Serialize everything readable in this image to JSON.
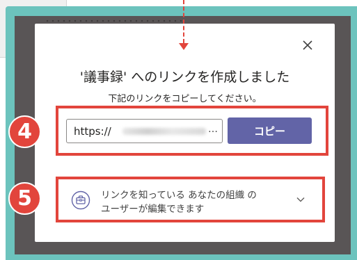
{
  "dialog": {
    "title": "'議事録' へのリンクを作成しました",
    "subtitle": "下記のリンクをコピーしてください。",
    "link_field_value": "https://",
    "link_ellipsis": "…",
    "copy_button_label": "コピー",
    "permission_line1": "リンクを知っている あなたの組織 の",
    "permission_line2": "ユーザーが編集できます"
  },
  "annotations": {
    "step4": "4",
    "step5": "5"
  },
  "icons": {
    "close": "close-icon",
    "permission": "briefcase-icon",
    "expand": "chevron-down-icon"
  },
  "colors": {
    "frame": "#6cc3bd",
    "overlay": "#595556",
    "annotation_red": "#e2453c",
    "primary_button": "#6264a7"
  }
}
